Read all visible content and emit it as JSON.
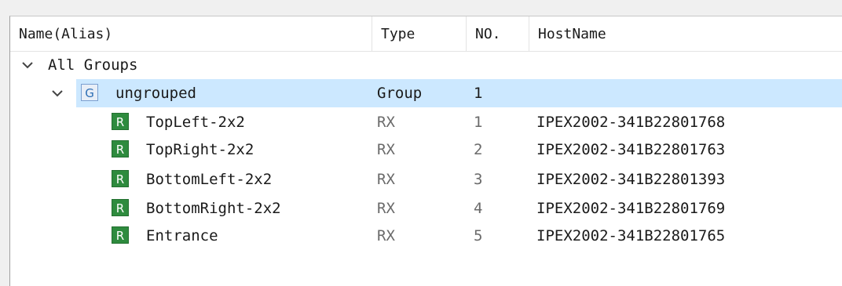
{
  "columns": {
    "name": "Name(Alias)",
    "type": "Type",
    "no": "NO.",
    "hostname": "HostName"
  },
  "tree": {
    "root_label": "All Groups",
    "group": {
      "badge": "G",
      "name": "ungrouped",
      "type": "Group",
      "no": "1",
      "hostname": ""
    },
    "devices": [
      {
        "badge": "R",
        "name": "TopLeft-2x2",
        "type": "RX",
        "no": "1",
        "hostname": "IPEX2002-341B22801768"
      },
      {
        "badge": "R",
        "name": "TopRight-2x2",
        "type": "RX",
        "no": "2",
        "hostname": "IPEX2002-341B22801763"
      },
      {
        "badge": "R",
        "name": "BottomLeft-2x2",
        "type": "RX",
        "no": "3",
        "hostname": "IPEX2002-341B22801393"
      },
      {
        "badge": "R",
        "name": "BottomRight-2x2",
        "type": "RX",
        "no": "4",
        "hostname": "IPEX2002-341B22801769"
      },
      {
        "badge": "R",
        "name": "Entrance",
        "type": "RX",
        "no": "5",
        "hostname": "IPEX2002-341B22801765"
      }
    ]
  },
  "colors": {
    "selection": "#cce8ff",
    "rx_badge": "#2e8b3e",
    "group_badge_text": "#2f6fb5"
  },
  "icons": {
    "expand": "chevron-down-icon",
    "group": "group-badge-icon",
    "rx": "rx-badge-icon"
  }
}
